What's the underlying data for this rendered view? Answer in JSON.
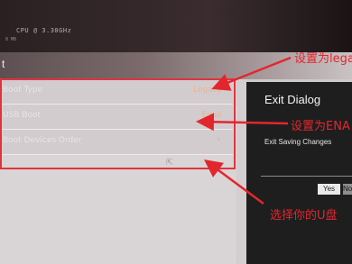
{
  "header": {
    "cpu_text": "CPU @ 3.30GHz",
    "mem_text": "8 MB",
    "page_title": "t"
  },
  "settings": {
    "rows": [
      {
        "label": "Boot Type",
        "value": "Legacy"
      },
      {
        "label": "USB Boot",
        "value": "Enab"
      },
      {
        "label": "Boot Devices Order",
        "value": "›"
      }
    ]
  },
  "dialog": {
    "title": "Exit Dialog",
    "message": "Exit Saving Changes",
    "yes_label": "Yes",
    "no_label": "No"
  },
  "annotations": {
    "legacy_note": "设置为lega",
    "enable_note": "设置为ENA",
    "usb_note": "选择你的U盘",
    "color": "#e3262e"
  },
  "icons": [
    "cursor-icon",
    "chevron-right-icon"
  ]
}
